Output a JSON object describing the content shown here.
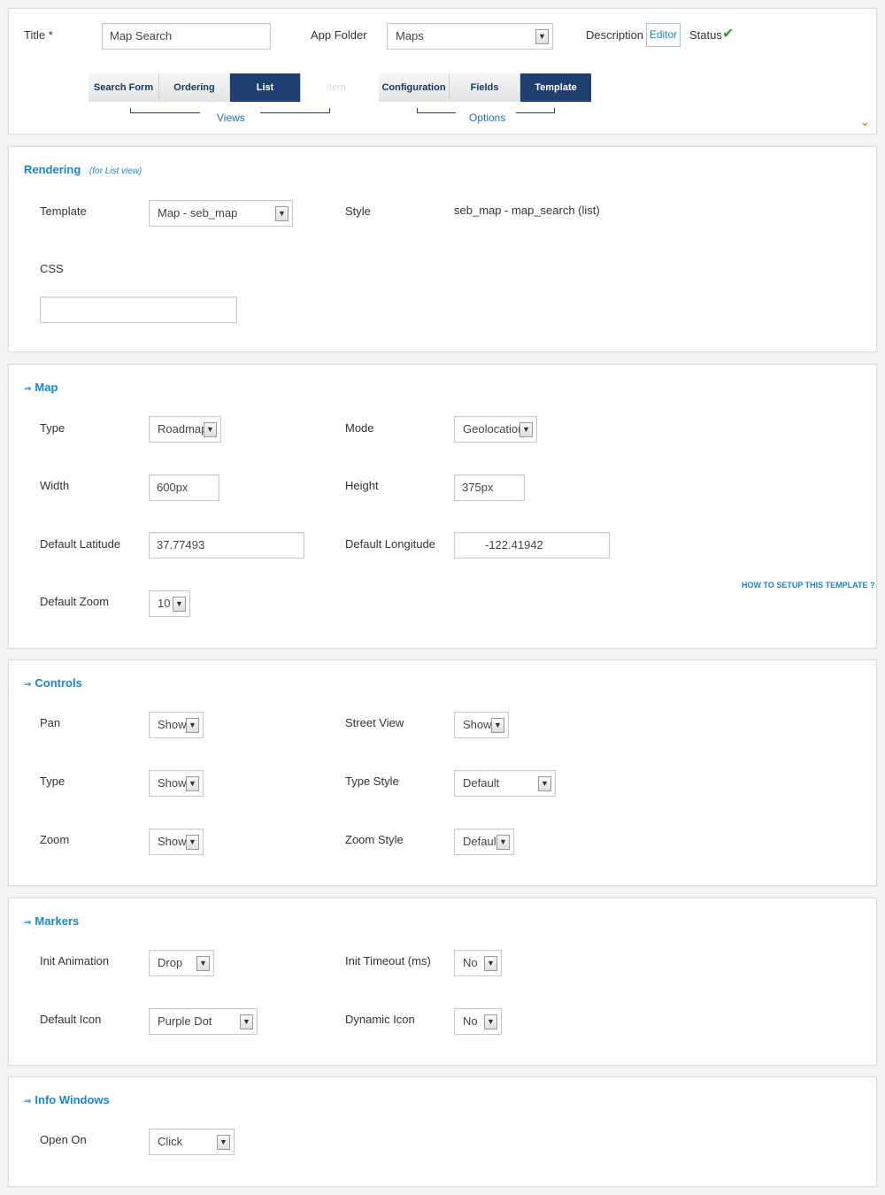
{
  "header": {
    "title_label": "Title *",
    "title_value": "Map Search",
    "app_folder_label": "App Folder",
    "app_folder_value": "Maps",
    "description_label": "Description",
    "editor_label": "Editor",
    "status_label": "Status",
    "status_icon": "checkmark-icon",
    "tabs_views": [
      {
        "label": "Search Form"
      },
      {
        "label": "Ordering"
      },
      {
        "label": "List"
      },
      {
        "label": "Item"
      }
    ],
    "tabs_options": [
      {
        "label": "Configuration"
      },
      {
        "label": "Fields"
      },
      {
        "label": "Template"
      }
    ],
    "views_label": "Views",
    "options_label": "Options",
    "collapse_icon": "chevron-down-icon",
    "accent_color": "#1f3f6e"
  },
  "rendering": {
    "title": "Rendering",
    "subtitle": "(for List view)",
    "template_label": "Template",
    "template_value": "Map - seb_map",
    "style_label": "Style",
    "style_value": "seb_map - map_search (list)",
    "css_label": "CSS",
    "css_value": ""
  },
  "map": {
    "title": "Map",
    "type_label": "Type",
    "type_value": "Roadmap",
    "mode_label": "Mode",
    "mode_value": "Geolocation",
    "width_label": "Width",
    "width_value": "600px",
    "height_label": "Height",
    "height_value": "375px",
    "lat_label": "Default Latitude",
    "lat_value": "37.77493",
    "lng_label": "Default Longitude",
    "lng_value": "-122.41942",
    "zoom_label": "Default Zoom",
    "zoom_value": "10",
    "help_link": "HOW TO SETUP THIS TEMPLATE ?"
  },
  "controls": {
    "title": "Controls",
    "pan_label": "Pan",
    "pan_value": "Show",
    "street_label": "Street View",
    "street_value": "Show",
    "type_label": "Type",
    "type_value": "Show",
    "type_style_label": "Type Style",
    "type_style_value": "Default",
    "zoom_label": "Zoom",
    "zoom_value": "Show",
    "zoom_style_label": "Zoom Style",
    "zoom_style_value": "Default"
  },
  "markers": {
    "title": "Markers",
    "anim_label": "Init Animation",
    "anim_value": "Drop",
    "timeout_label": "Init Timeout (ms)",
    "timeout_value": "No",
    "icon_label": "Default Icon",
    "icon_value": "Purple Dot",
    "dyn_label": "Dynamic Icon",
    "dyn_value": "No"
  },
  "info_windows": {
    "title": "Info Windows",
    "open_label": "Open On",
    "open_value": "Click"
  }
}
